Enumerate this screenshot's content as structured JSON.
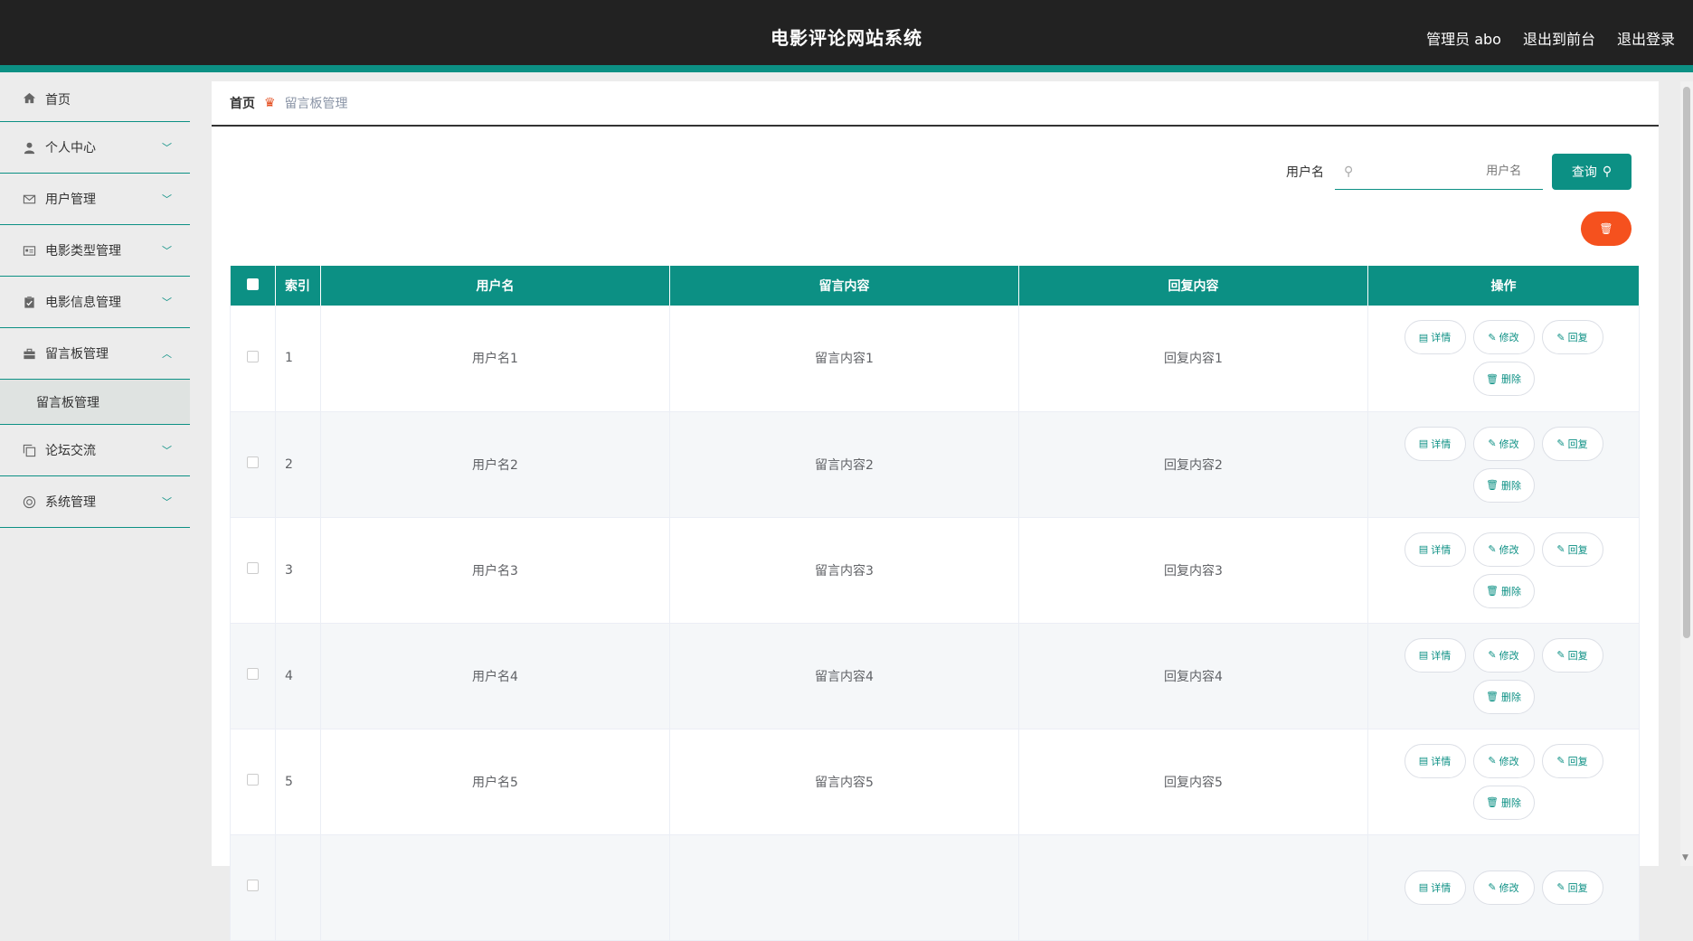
{
  "header": {
    "title": "电影评论网站系统",
    "admin": "管理员 abo",
    "to_front": "退出到前台",
    "logout": "退出登录"
  },
  "sidebar": {
    "items": [
      {
        "label": "首页",
        "icon": "home-icon"
      },
      {
        "label": "个人中心",
        "icon": "user-icon"
      },
      {
        "label": "用户管理",
        "icon": "mail-icon"
      },
      {
        "label": "电影类型管理",
        "icon": "id-card-icon"
      },
      {
        "label": "电影信息管理",
        "icon": "clipboard-icon"
      },
      {
        "label": "留言板管理",
        "icon": "briefcase-icon"
      },
      {
        "label": "论坛交流",
        "icon": "copy-icon"
      },
      {
        "label": "系统管理",
        "icon": "lifebuoy-icon"
      }
    ],
    "submenu": "留言板管理"
  },
  "breadcrumb": {
    "home": "首页",
    "current": "留言板管理"
  },
  "search": {
    "label": "用户名",
    "placeholder": "用户名",
    "button": "查询"
  },
  "table": {
    "headers": [
      "索引",
      "用户名",
      "留言内容",
      "回复内容",
      "操作"
    ],
    "rows": [
      {
        "index": "1",
        "username": "用户名1",
        "message": "留言内容1",
        "reply": "回复内容1"
      },
      {
        "index": "2",
        "username": "用户名2",
        "message": "留言内容2",
        "reply": "回复内容2"
      },
      {
        "index": "3",
        "username": "用户名3",
        "message": "留言内容3",
        "reply": "回复内容3"
      },
      {
        "index": "4",
        "username": "用户名4",
        "message": "留言内容4",
        "reply": "回复内容4"
      },
      {
        "index": "5",
        "username": "用户名5",
        "message": "留言内容5",
        "reply": "回复内容5"
      }
    ],
    "actions": {
      "detail": "详情",
      "edit": "修改",
      "reply": "回复",
      "delete": "删除"
    }
  },
  "colors": {
    "accent": "#0c9084",
    "header_bg": "#222222",
    "danger": "#f5511e"
  }
}
